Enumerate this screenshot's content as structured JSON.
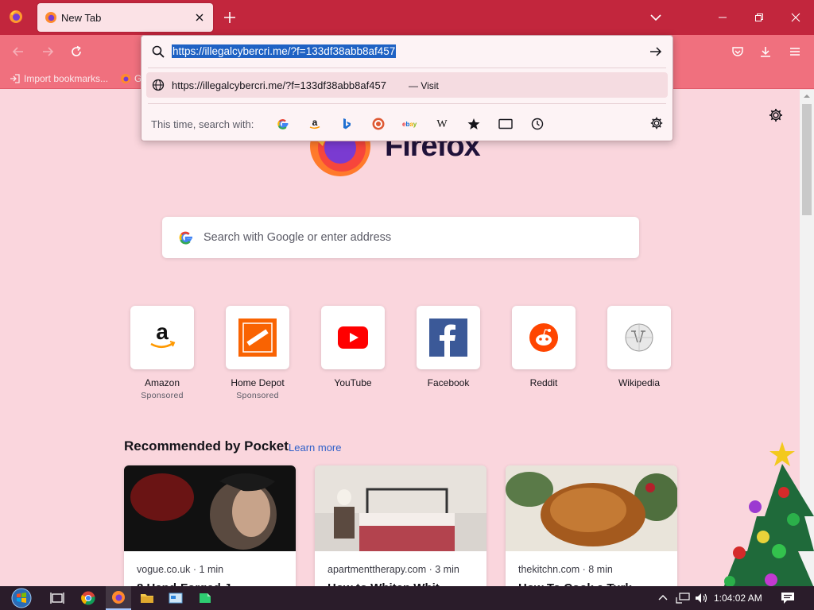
{
  "browser": {
    "tab": {
      "title": "New Tab"
    },
    "bookmarks": [
      {
        "label": "Import bookmarks..."
      },
      {
        "label": "G"
      }
    ]
  },
  "urlbar": {
    "value": "https://illegalcybercri.me/?f=133df38abb8af457",
    "suggestion": {
      "url": "https://illegalcybercri.me/?f=133df38abb8af457",
      "separator": "—",
      "action": "Visit"
    },
    "oneoff_label": "This time, search with:",
    "engines": [
      "google-icon",
      "amazon-icon",
      "bing-icon",
      "duckduckgo-icon",
      "ebay-icon",
      "wikipedia-icon",
      "bookmarks-star-icon",
      "tabs-icon",
      "history-clock-icon"
    ]
  },
  "newtab": {
    "logo_text": "Firefox",
    "search_placeholder": "Search with Google or enter address",
    "top_sites": [
      {
        "title": "Amazon",
        "sponsored": "Sponsored",
        "icon": "amazon-logo-icon"
      },
      {
        "title": "Home Depot",
        "sponsored": "Sponsored",
        "icon": "home-depot-logo-icon"
      },
      {
        "title": "YouTube",
        "sponsored": "",
        "icon": "youtube-logo-icon"
      },
      {
        "title": "Facebook",
        "sponsored": "",
        "icon": "facebook-logo-icon"
      },
      {
        "title": "Reddit",
        "sponsored": "",
        "icon": "reddit-logo-icon"
      },
      {
        "title": "Wikipedia",
        "sponsored": "",
        "icon": "wikipedia-logo-icon"
      }
    ],
    "pocket": {
      "heading": "Recommended by Pocket",
      "learn_more": "Learn more",
      "cards": [
        {
          "source": "vogue.co.uk · 1 min",
          "title": "8 Hand-Forged J"
        },
        {
          "source": "apartmenttherapy.com · 3 min",
          "title": "How to Whiten Whit"
        },
        {
          "source": "thekitchn.com · 8 min",
          "title": "How To Cook a Turk"
        }
      ]
    }
  },
  "taskbar": {
    "clock": "1:04:02 AM"
  },
  "colors": {
    "tabstrip": "#c2263d",
    "toolbar": "#f0707e",
    "page_bg": "#fad6dd",
    "selection": "#1f62c4"
  }
}
